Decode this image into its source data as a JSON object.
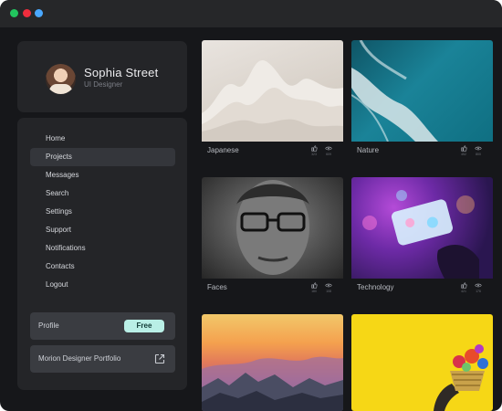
{
  "window": {
    "controls": [
      "close",
      "minimize",
      "maximize"
    ]
  },
  "profile": {
    "name": "Sophia Street",
    "role": "UI Designer"
  },
  "nav": {
    "items": [
      {
        "label": "Home",
        "active": false
      },
      {
        "label": "Projects",
        "active": true
      },
      {
        "label": "Messages",
        "active": false
      },
      {
        "label": "Search",
        "active": false
      },
      {
        "label": "Settings",
        "active": false
      },
      {
        "label": "Support",
        "active": false
      },
      {
        "label": "Notifications",
        "active": false
      },
      {
        "label": "Contacts",
        "active": false
      },
      {
        "label": "Logout",
        "active": false
      }
    ]
  },
  "plan": {
    "label": "Profile",
    "badge": "Free"
  },
  "portfolio_link": {
    "label": "Morion Designer Portfolio",
    "icon": "external-link-icon"
  },
  "gallery": {
    "items": [
      {
        "title": "Japanese",
        "likes": "323",
        "views": "609"
      },
      {
        "title": "Nature",
        "likes": "452",
        "views": "800"
      },
      {
        "title": "Faces",
        "likes": "180",
        "views": "108"
      },
      {
        "title": "Technology",
        "likes": "421",
        "views": "176"
      },
      {
        "title": "",
        "likes": "",
        "views": ""
      },
      {
        "title": "",
        "likes": "",
        "views": ""
      }
    ]
  },
  "colors": {
    "background": "#16171a",
    "panel": "#242528",
    "active": "#34363b",
    "badge": "#b9efe6"
  }
}
